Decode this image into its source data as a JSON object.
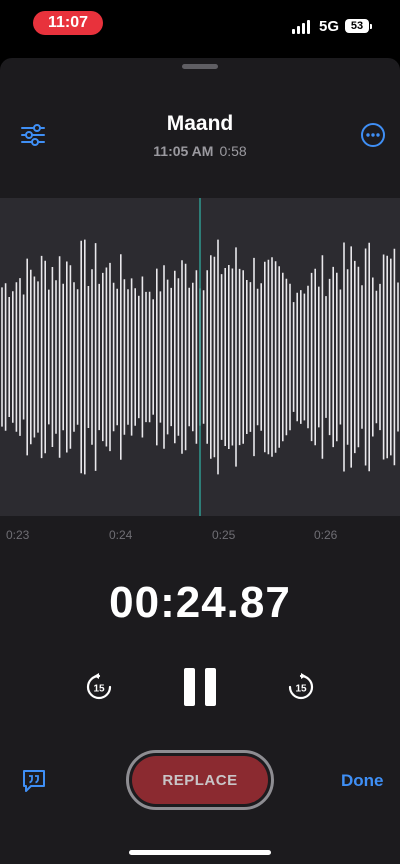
{
  "status_bar": {
    "time": "11:07",
    "network": "5G",
    "battery_level": "53"
  },
  "recording": {
    "title": "Maand",
    "recorded_time": "11:05 AM",
    "duration": "0:58",
    "elapsed": "00:24.87",
    "playhead_fraction": 0.43
  },
  "timeline": {
    "ticks": [
      "0:23",
      "0:24",
      "0:25",
      "0:26"
    ]
  },
  "controls": {
    "skip_back_seconds": "15",
    "skip_forward_seconds": "15",
    "replace_label": "REPLACE",
    "done_label": "Done"
  },
  "icons": {
    "options": "sliders-icon",
    "more": "ellipsis-circle-icon",
    "skip_back": "rewind-15-icon",
    "skip_forward": "forward-15-icon",
    "pause": "pause-icon",
    "transcript": "quote-bubble-icon"
  },
  "colors": {
    "accent": "#3f8ff5",
    "record_red": "#8b2a30",
    "status_red": "#e8323c",
    "playhead": "#2f9a8f"
  }
}
